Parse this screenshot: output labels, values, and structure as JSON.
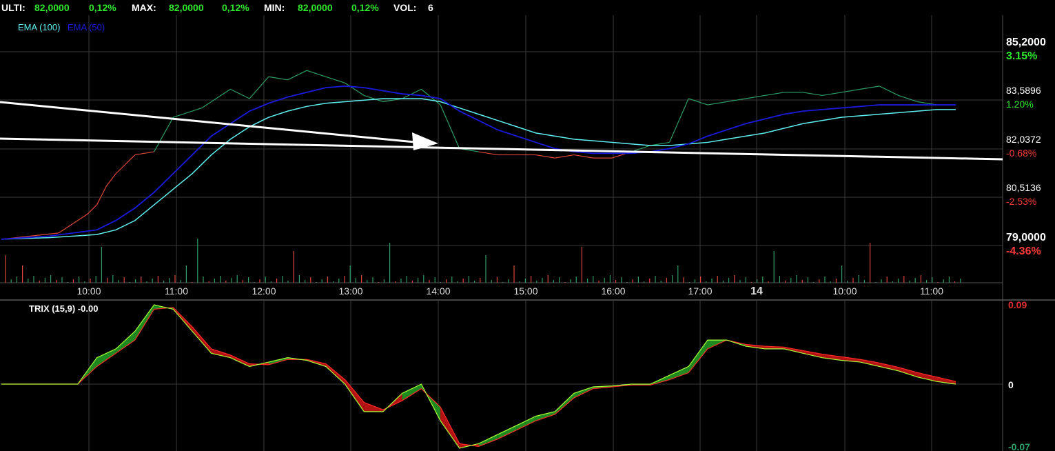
{
  "header": {
    "ulti_label": "ULTI:",
    "ulti_value": "82,0000",
    "ulti_pct": "0,12%",
    "max_label": "MAX:",
    "max_value": "82,0000",
    "max_pct": "0,12%",
    "min_label": "MIN:",
    "min_value": "82,0000",
    "min_pct": "0,12%",
    "vol_label": "VOL:",
    "vol_value": "6"
  },
  "legend": {
    "ema100": "EMA (100)",
    "ema50": "EMA (50)"
  },
  "colors": {
    "background": "#000000",
    "grid": "#3a3a3a",
    "price_up": "#2e9e66",
    "price_down": "#e0463c",
    "ema100": "#5ef0f0",
    "ema50": "#1a1adf",
    "trendline": "#ffffff",
    "trix_up": "#1f8a1f",
    "trix_down": "#b31212",
    "trix_line": "#a8ff3a",
    "signal_line": "#ff2a2a",
    "pos_text": "#2ee82e",
    "neg_text": "#ff3b3b"
  },
  "price_axis": [
    {
      "value": "85,2000",
      "pct": "3.15%",
      "sign": "pos",
      "big": true
    },
    {
      "value": "83,5896",
      "pct": "1.20%",
      "sign": "pos",
      "big": false
    },
    {
      "value": "82,0372",
      "pct": "-0.68%",
      "sign": "neg",
      "big": false
    },
    {
      "value": "80,5136",
      "pct": "-2.53%",
      "sign": "neg",
      "big": false
    },
    {
      "value": "79,0000",
      "pct": "-4.36%",
      "sign": "neg",
      "big": true
    }
  ],
  "time_axis": [
    "10:00",
    "11:00",
    "12:00",
    "13:00",
    "14:00",
    "15:00",
    "16:00",
    "17:00",
    "14",
    "10:00",
    "11:00"
  ],
  "trix": {
    "label": "TRIX (15,9) -0.00",
    "axis": [
      {
        "value": "0.09",
        "sign": "neg"
      },
      {
        "value": "0",
        "sign": "zero"
      },
      {
        "value": "-0.07",
        "sign": "pos"
      }
    ]
  },
  "chart_data": {
    "type": "line",
    "title": "",
    "ylim": [
      79.0,
      85.2
    ],
    "series": [
      {
        "name": "Price",
        "x": [
          0,
          3,
          6,
          9,
          10,
          11,
          12,
          14,
          16,
          18,
          20,
          21,
          22,
          24,
          26,
          28,
          30,
          32,
          34,
          36,
          37,
          38,
          40,
          42,
          44,
          46,
          48,
          50,
          52,
          54,
          56,
          58,
          60,
          62,
          64,
          66,
          68,
          70,
          72,
          74,
          76,
          78,
          80,
          82,
          84,
          86,
          88,
          90,
          92,
          94,
          96,
          98,
          100
        ],
        "values": [
          79.2,
          79.3,
          79.4,
          80.0,
          80.3,
          80.9,
          81.3,
          81.9,
          82.0,
          83.1,
          83.3,
          83.4,
          83.6,
          84.0,
          83.7,
          84.4,
          84.3,
          84.6,
          84.4,
          84.2,
          84.0,
          83.8,
          83.6,
          83.7,
          84.0,
          83.5,
          82.1,
          82.0,
          81.9,
          81.9,
          81.9,
          81.8,
          81.9,
          81.8,
          81.8,
          82.0,
          82.2,
          82.3,
          83.7,
          83.5,
          83.6,
          83.7,
          83.8,
          83.9,
          83.9,
          83.8,
          83.9,
          84.0,
          84.1,
          83.8,
          83.6,
          83.5,
          83.5
        ]
      },
      {
        "name": "EMA (100)",
        "x": [
          0,
          5,
          10,
          12,
          14,
          16,
          18,
          20,
          22,
          24,
          26,
          28,
          30,
          32,
          34,
          36,
          38,
          40,
          42,
          44,
          46,
          48,
          50,
          52,
          54,
          56,
          58,
          60,
          62,
          64,
          66,
          68,
          70,
          72,
          74,
          76,
          78,
          80,
          82,
          84,
          86,
          88,
          90,
          92,
          94,
          96,
          98,
          100
        ],
        "values": [
          79.2,
          79.25,
          79.35,
          79.5,
          79.8,
          80.3,
          80.8,
          81.3,
          81.9,
          82.4,
          82.8,
          83.1,
          83.3,
          83.45,
          83.55,
          83.6,
          83.65,
          83.7,
          83.7,
          83.7,
          83.6,
          83.4,
          83.2,
          83.0,
          82.8,
          82.6,
          82.5,
          82.4,
          82.35,
          82.3,
          82.25,
          82.2,
          82.2,
          82.25,
          82.3,
          82.4,
          82.5,
          82.6,
          82.75,
          82.9,
          83.0,
          83.1,
          83.15,
          83.2,
          83.25,
          83.3,
          83.35,
          83.35
        ]
      },
      {
        "name": "EMA (50)",
        "x": [
          0,
          5,
          10,
          12,
          14,
          16,
          18,
          20,
          22,
          24,
          26,
          28,
          30,
          32,
          34,
          36,
          38,
          40,
          42,
          44,
          46,
          48,
          50,
          52,
          54,
          56,
          58,
          60,
          62,
          64,
          66,
          68,
          70,
          72,
          74,
          76,
          78,
          80,
          82,
          84,
          86,
          88,
          90,
          92,
          94,
          96,
          98,
          100
        ],
        "values": [
          79.2,
          79.3,
          79.5,
          79.8,
          80.2,
          80.7,
          81.3,
          81.9,
          82.5,
          82.9,
          83.3,
          83.55,
          83.75,
          83.9,
          84.05,
          84.1,
          84.05,
          83.95,
          83.85,
          83.8,
          83.7,
          83.3,
          83.0,
          82.7,
          82.5,
          82.3,
          82.1,
          82.0,
          81.95,
          81.95,
          81.95,
          82.0,
          82.1,
          82.25,
          82.5,
          82.7,
          82.9,
          83.05,
          83.2,
          83.3,
          83.35,
          83.4,
          83.45,
          83.5,
          83.5,
          83.5,
          83.5,
          83.5
        ]
      },
      {
        "name": "TRIX",
        "x": [
          0,
          5,
          8,
          10,
          12,
          14,
          16,
          18,
          20,
          22,
          24,
          26,
          28,
          30,
          32,
          34,
          36,
          38,
          40,
          42,
          44,
          46,
          48,
          50,
          52,
          54,
          56,
          58,
          60,
          62,
          64,
          66,
          68,
          70,
          72,
          74,
          76,
          78,
          80,
          82,
          84,
          86,
          88,
          90,
          92,
          94,
          96,
          98,
          100
        ],
        "values": [
          0.0,
          0.0,
          0.0,
          0.03,
          0.04,
          0.06,
          0.09,
          0.085,
          0.06,
          0.035,
          0.03,
          0.02,
          0.025,
          0.03,
          0.027,
          0.02,
          0.0,
          -0.03,
          -0.03,
          -0.01,
          0.0,
          -0.04,
          -0.07,
          -0.065,
          -0.055,
          -0.045,
          -0.035,
          -0.03,
          -0.01,
          -0.003,
          -0.002,
          0.0,
          0.0,
          0.01,
          0.02,
          0.05,
          0.05,
          0.043,
          0.04,
          0.04,
          0.035,
          0.03,
          0.027,
          0.025,
          0.02,
          0.015,
          0.008,
          0.003,
          0.0
        ]
      },
      {
        "name": "Signal",
        "x": [
          0,
          5,
          8,
          10,
          12,
          14,
          16,
          18,
          20,
          22,
          24,
          26,
          28,
          30,
          32,
          34,
          36,
          38,
          40,
          42,
          44,
          46,
          48,
          50,
          52,
          54,
          56,
          58,
          60,
          62,
          64,
          66,
          68,
          70,
          72,
          74,
          76,
          78,
          80,
          82,
          84,
          86,
          88,
          90,
          92,
          94,
          96,
          98,
          100
        ],
        "values": [
          0.0,
          0.0,
          0.0,
          0.02,
          0.035,
          0.05,
          0.085,
          0.087,
          0.065,
          0.04,
          0.033,
          0.023,
          0.022,
          0.028,
          0.028,
          0.023,
          0.005,
          -0.02,
          -0.028,
          -0.018,
          -0.005,
          -0.025,
          -0.065,
          -0.068,
          -0.06,
          -0.05,
          -0.04,
          -0.033,
          -0.015,
          -0.005,
          -0.003,
          -0.001,
          -0.001,
          0.005,
          0.013,
          0.04,
          0.05,
          0.045,
          0.043,
          0.042,
          0.038,
          0.034,
          0.031,
          0.028,
          0.024,
          0.019,
          0.013,
          0.008,
          0.003
        ]
      }
    ]
  }
}
